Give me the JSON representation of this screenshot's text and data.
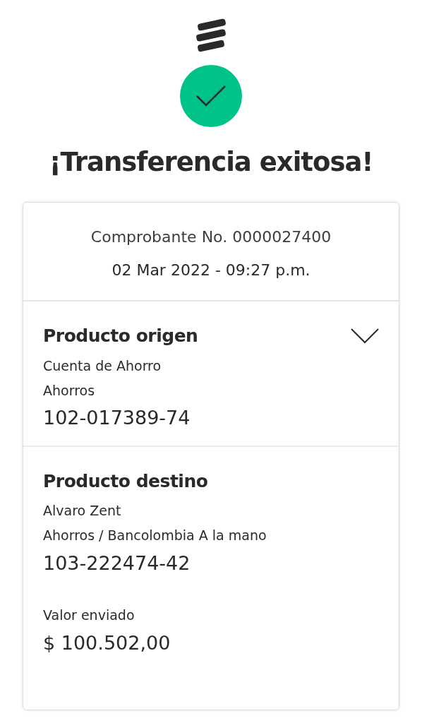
{
  "header": {
    "title": "¡Transferencia exitosa!"
  },
  "receipt": {
    "number": "Comprobante No. 0000027400",
    "datetime": "02 Mar 2022 - 09:27 p.m."
  },
  "sections": [
    {
      "kind": "collapsible",
      "title": "Producto origen",
      "details": [
        "Cuenta de Ahorro",
        "Ahorros"
      ],
      "account": "102-017389-74"
    },
    {
      "kind": "plain",
      "title": "Producto destino",
      "details": [
        "Alvaro Zent",
        "Ahorros / Bancolombia A la mano"
      ],
      "account": "103-222474-42",
      "amount": {
        "label": "Valor enviado",
        "value": "$ 100.502,00"
      }
    }
  ]
}
